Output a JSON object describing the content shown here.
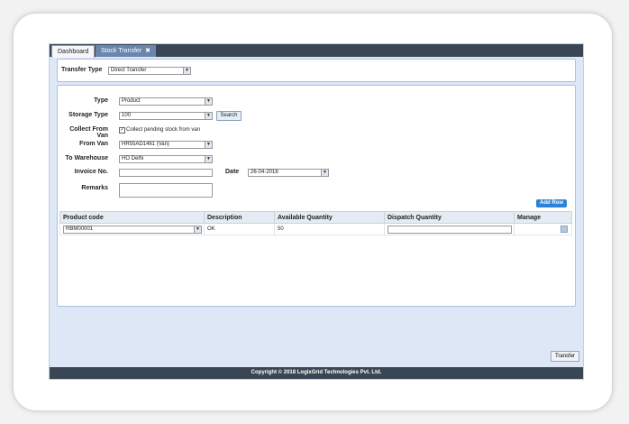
{
  "tabs": [
    {
      "label": "Dashboard"
    },
    {
      "label": "Stock Transfer",
      "close": "✖"
    }
  ],
  "transfer_type": {
    "label": "Transfer Type",
    "value": "Direct Transfer"
  },
  "form": {
    "type": {
      "label": "Type",
      "value": "Product"
    },
    "storage_type": {
      "label": "Storage Type",
      "value": "100",
      "search_label": "Search"
    },
    "collect_from_van": {
      "label": "Collect From Van",
      "checkbox_label": "Collect pending stock from van",
      "checked": true
    },
    "from_van": {
      "label": "From Van",
      "value": "HR55AD1461 (Van)"
    },
    "to_warehouse": {
      "label": "To Warehouse",
      "value": "HO Delhi"
    },
    "invoice_no": {
      "label": "Invoice No.",
      "value": ""
    },
    "date": {
      "label": "Date",
      "value": "26-04-2018"
    },
    "remarks": {
      "label": "Remarks",
      "value": ""
    }
  },
  "add_row_label": "Add Row",
  "table": {
    "headers": [
      "Product code",
      "Description",
      "Available Quantity",
      "Dispatch Quantity",
      "Manage"
    ],
    "rows": [
      {
        "product_code": "RBM00001",
        "description": "OK",
        "available_quantity": "50",
        "dispatch_quantity": ""
      }
    ]
  },
  "transfer_label": "Transfer",
  "footer": "Copyright © 2018 LogixGrid Technologies Pvt. Ltd."
}
